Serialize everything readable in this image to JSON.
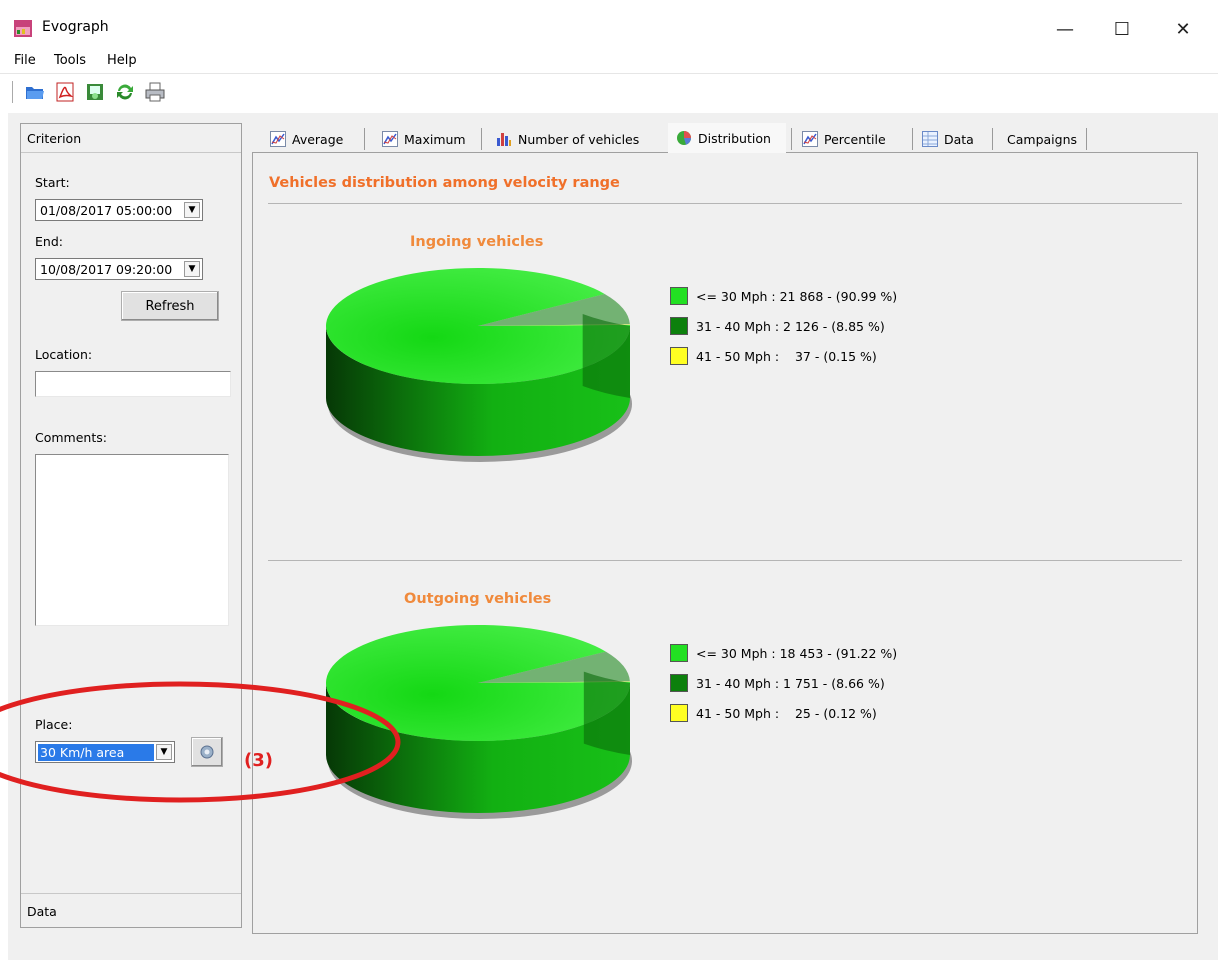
{
  "window": {
    "title": "Evograph",
    "controls": {
      "minimize": "—",
      "maximize": "☐",
      "close": "✕"
    }
  },
  "menu": {
    "items": [
      "File",
      "Tools",
      "Help"
    ]
  },
  "toolbar": {
    "icons": [
      "open-folder-icon",
      "pdf-icon",
      "export-icon",
      "refresh-icon",
      "print-icon"
    ]
  },
  "left_panel": {
    "header": "Criterion",
    "start_label": "Start:",
    "start_value": "01/08/2017 05:00:00",
    "end_label": "End:",
    "end_value": "10/08/2017 09:20:00",
    "refresh_label": "Refresh",
    "location_label": "Location:",
    "location_value": "",
    "comments_label": "Comments:",
    "comments_value": "",
    "place_label": "Place:",
    "place_value": "30 Km/h area",
    "footer": "Data"
  },
  "tabs": [
    {
      "label": "Average",
      "icon": "line-chart-icon"
    },
    {
      "label": "Maximum",
      "icon": "line-chart-icon"
    },
    {
      "label": "Number of vehicles",
      "icon": "bar-chart-icon"
    },
    {
      "label": "Distribution",
      "icon": "pie-chart-icon",
      "active": true
    },
    {
      "label": "Percentile",
      "icon": "line-chart-icon"
    },
    {
      "label": "Data",
      "icon": "table-icon"
    },
    {
      "label": "Campaigns",
      "icon": ""
    }
  ],
  "main": {
    "section_title": "Vehicles distribution among velocity range"
  },
  "annotation": {
    "label": "(3)",
    "color": "#e02020"
  },
  "colors": {
    "range_low": "#22e022",
    "range_mid": "#0c800c",
    "range_high": "#ffff22",
    "accent": "#f0702a"
  },
  "chart_data": [
    {
      "type": "pie",
      "title": "Ingoing vehicles",
      "labels": [
        "<= 30 Mph",
        "31 - 40 Mph",
        "41 - 50 Mph"
      ],
      "values": [
        21868,
        2126,
        37
      ],
      "percents": [
        90.99,
        8.85,
        0.15
      ],
      "legend": [
        "<= 30 Mph : 21 868 - (90.99 %)",
        "31 - 40 Mph : 2 126 - (8.85 %)",
        "41 - 50 Mph :    37 - (0.15 %)"
      ]
    },
    {
      "type": "pie",
      "title": "Outgoing vehicles",
      "labels": [
        "<= 30 Mph",
        "31 - 40 Mph",
        "41 - 50 Mph"
      ],
      "values": [
        18453,
        1751,
        25
      ],
      "percents": [
        91.22,
        8.66,
        0.12
      ],
      "legend": [
        "<= 30 Mph : 18 453 - (91.22 %)",
        "31 - 40 Mph : 1 751 - (8.66 %)",
        "41 - 50 Mph :    25 - (0.12 %)"
      ]
    }
  ]
}
